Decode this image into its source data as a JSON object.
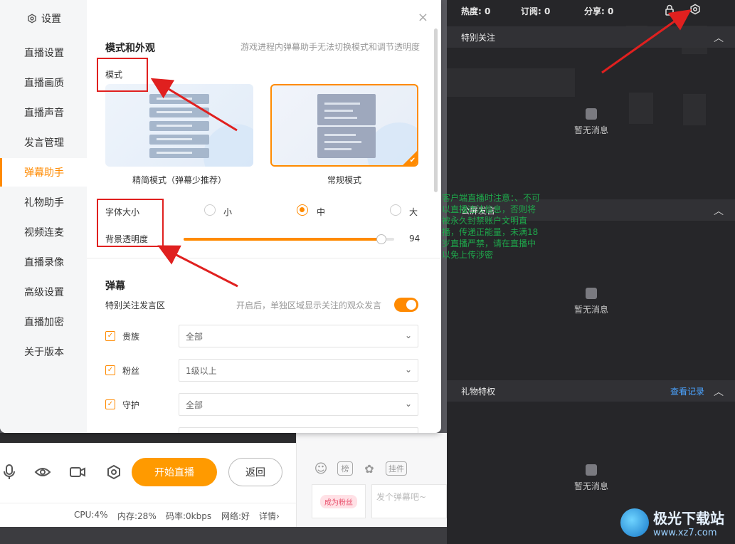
{
  "dialog": {
    "title": "设置",
    "close_icon": "×",
    "sidebar": {
      "items": [
        {
          "label": "直播设置"
        },
        {
          "label": "直播画质"
        },
        {
          "label": "直播声音"
        },
        {
          "label": "发言管理"
        },
        {
          "label": "弹幕助手",
          "active": true
        },
        {
          "label": "礼物助手"
        },
        {
          "label": "视频连麦"
        },
        {
          "label": "直播录像"
        },
        {
          "label": "高级设置"
        },
        {
          "label": "直播加密"
        },
        {
          "label": "关于版本"
        }
      ]
    },
    "appearance": {
      "title": "模式和外观",
      "hint": "游戏进程内弹幕助手无法切换模式和调节透明度",
      "mode_label": "模式",
      "modes": [
        {
          "caption": "精简模式（弹幕少推荐）",
          "selected": false
        },
        {
          "caption": "常规模式",
          "selected": true
        }
      ],
      "font_size_label": "字体大小",
      "font_sizes": [
        {
          "label": "小",
          "selected": false
        },
        {
          "label": "中",
          "selected": true
        },
        {
          "label": "大",
          "selected": false
        }
      ],
      "opacity_label": "背景透明度",
      "opacity_value": "94",
      "opacity_fraction": 0.94
    },
    "danmaku": {
      "title": "弹幕",
      "special_label": "特别关注发言区",
      "special_hint": "开启后，单独区域显示关注的观众发言",
      "special_on": true,
      "filters": [
        {
          "label": "贵族",
          "checked": true,
          "value": "全部"
        },
        {
          "label": "粉丝",
          "checked": true,
          "value": "1级以上"
        },
        {
          "label": "守护",
          "checked": true,
          "value": "全部"
        }
      ]
    }
  },
  "toolbar": {
    "icons": [
      "microphone-icon",
      "eye-icon",
      "camera-icon",
      "gear-icon"
    ],
    "start_label": "开始直播",
    "back_label": "返回"
  },
  "status": {
    "cpu": "CPU:4%",
    "mem": "内存:28%",
    "bitrate": "码率:0kbps",
    "network": "网络:好",
    "detail": "详情",
    "detail_arrow": "›"
  },
  "chat": {
    "tools": [
      {
        "name": "emoji-icon",
        "text": "☺"
      },
      {
        "name": "mod-icon",
        "text": "榜"
      },
      {
        "name": "palette-icon",
        "text": "✿"
      },
      {
        "name": "plugin-button",
        "text": "挂件"
      }
    ],
    "fan_badge": "成为粉丝",
    "input_placeholder": "发个弹幕吧~"
  },
  "panel": {
    "stats": [
      {
        "label": "热度: 0"
      },
      {
        "label": "订阅: 0"
      },
      {
        "label": "分享: 0"
      }
    ],
    "sections": [
      {
        "title": "特别关注",
        "empty": "暂无消息"
      },
      {
        "title": "公屏发言",
        "empty": "暂无消息"
      },
      {
        "title": "礼物特权",
        "empty": "暂无消息",
        "link": "查看记录"
      }
    ],
    "background_text": "客户端直播时注意：、不可以直播违法信息，否则将被永久封禁账户文明直播，传递正能量，未满18岁直播严禁，请在直播中以免上传涉密"
  },
  "watermark": {
    "name": "极光下载站",
    "url": "www.xz7.com"
  },
  "colors": {
    "accent": "#ff8a00",
    "start_button": "#ff9a00",
    "link_blue": "#4aa3ff",
    "annotation_red": "#e0201f",
    "panel_bg": "#262629"
  }
}
